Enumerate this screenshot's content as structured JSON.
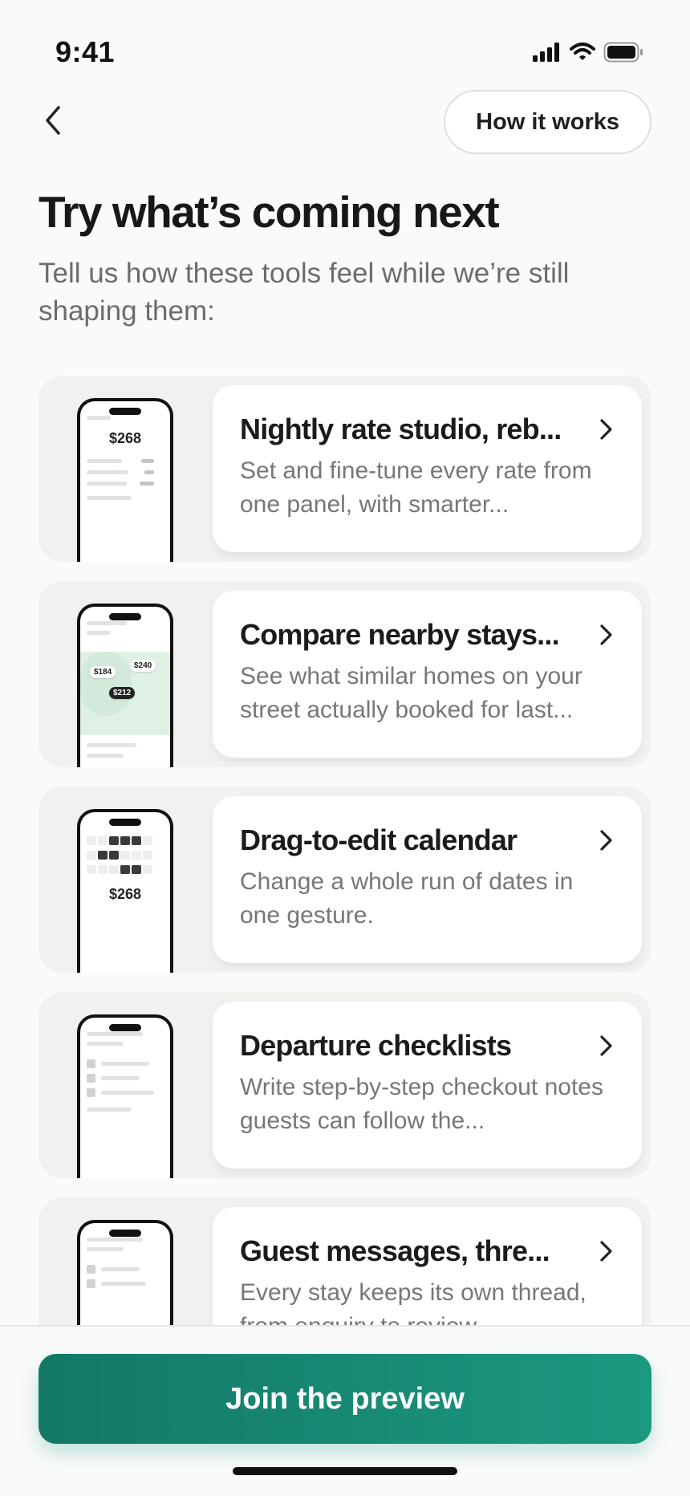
{
  "status_bar": {
    "time": "9:41"
  },
  "header": {
    "how_it_works_label": "How it works"
  },
  "page": {
    "title": "Try what’s coming next",
    "subtitle": "Tell us how these tools feel while we’re still shaping them:"
  },
  "features": [
    {
      "title": "Nightly rate studio, reb...",
      "description": "Set and fine-tune every rate from one panel, with smarter...",
      "mock_price": "$268"
    },
    {
      "title": "Compare nearby stays...",
      "description": "See what similar homes on your street actually booked for last...",
      "mock_pins": [
        "$184",
        "$240",
        "$212"
      ]
    },
    {
      "title": "Drag-to-edit calendar",
      "description": "Change a whole run of dates in one gesture.",
      "mock_price": "$268"
    },
    {
      "title": "Departure checklists",
      "description": "Write step-by-step checkout notes guests can follow the..."
    },
    {
      "title": "Guest messages, thre...",
      "description": "Every stay keeps its own thread, from enquiry to review."
    }
  ],
  "footer": {
    "join_label": "Join the preview"
  }
}
